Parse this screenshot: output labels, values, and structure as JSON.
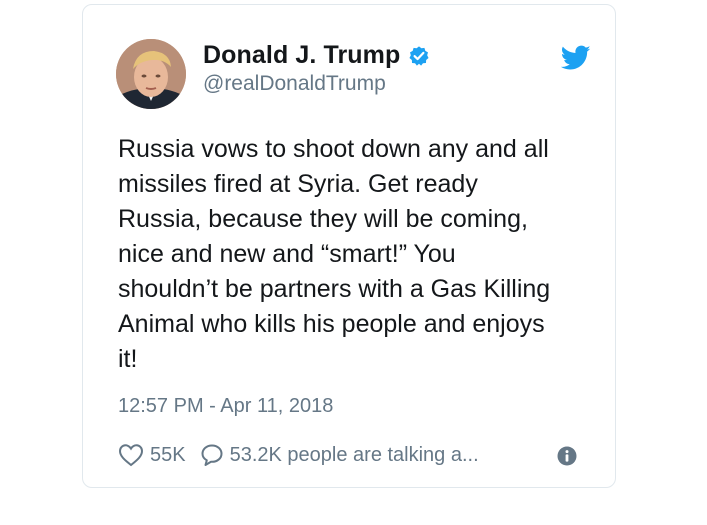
{
  "author": {
    "name": "Donald J. Trump",
    "handle": "@realDonaldTrump"
  },
  "tweet": {
    "text": "Russia vows to shoot down any and all\nmissiles fired at Syria. Get ready\nRussia,  because they will be coming,\nnice and new and “smart!” You\nshouldn’t be partners with a Gas Killing\nAnimal who kills his people and enjoys\nit!",
    "timestamp": "12:57 PM - Apr 11, 2018"
  },
  "actions": {
    "likes": "55K",
    "talking": "53.2K people are talking a..."
  },
  "icons": {
    "verified": "verified-badge-icon",
    "brand": "twitter-bird-icon",
    "like": "heart-icon",
    "reply": "speech-bubble-icon",
    "info": "info-icon"
  },
  "colors": {
    "brand": "#1da1f2",
    "text": "#14171a",
    "secondary": "#657786",
    "border": "#e1e8ed"
  }
}
